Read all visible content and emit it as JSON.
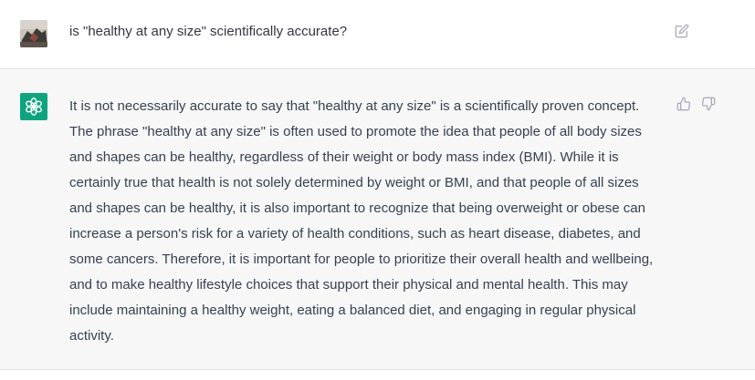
{
  "conversation": {
    "user_message": {
      "text": "is \"healthy at any size\" scientifically accurate?",
      "avatar_icon": "user-photo-avatar",
      "edit_icon": "edit-icon"
    },
    "assistant_message": {
      "avatar_icon": "openai-logo-icon",
      "avatar_color": "#10a37f",
      "text": "It is not necessarily accurate to say that \"healthy at any size\" is a scientifically proven concept. The phrase \"healthy at any size\" is often used to promote the idea that people of all body sizes and shapes can be healthy, regardless of their weight or body mass index (BMI). While it is certainly true that health is not solely determined by weight or BMI, and that people of all sizes and shapes can be healthy, it is also important to recognize that being overweight or obese can increase a person's risk for a variety of health conditions, such as heart disease, diabetes, and some cancers. Therefore, it is important for people to prioritize their overall health and wellbeing, and to make healthy lifestyle choices that support their physical and mental health. This may include maintaining a healthy weight, eating a balanced diet, and engaging in regular physical activity.",
      "feedback_icons": [
        "thumbs-up-icon",
        "thumbs-down-icon"
      ]
    }
  },
  "colors": {
    "user_row_bg": "#ffffff",
    "assistant_row_bg": "#f7f7f8",
    "text": "#374151",
    "icon": "#acacbe"
  }
}
